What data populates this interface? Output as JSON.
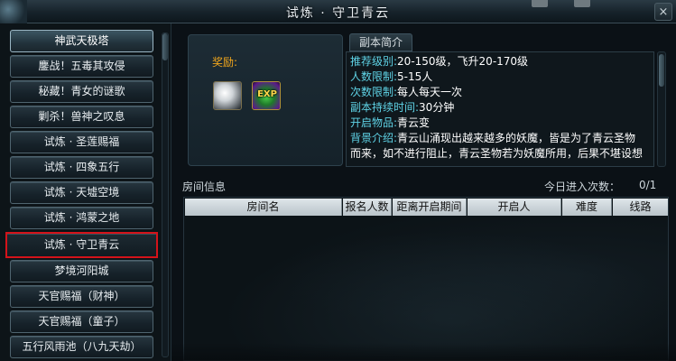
{
  "window": {
    "title": "试炼 · 守卫青云",
    "close_icon": "×"
  },
  "dungeon_list": {
    "items": [
      {
        "label": "神武天极塔",
        "state": "active"
      },
      {
        "label": "鏖战！五毒其攻侵",
        "state": "normal"
      },
      {
        "label": "秘藏！青女的谜歌",
        "state": "normal"
      },
      {
        "label": "剿杀！兽神之叹息",
        "state": "normal"
      },
      {
        "label": "试炼 · 圣莲赐福",
        "state": "normal"
      },
      {
        "label": "试炼 · 四象五行",
        "state": "normal"
      },
      {
        "label": "试炼 · 天墟空境",
        "state": "normal"
      },
      {
        "label": "试炼 · 鸿蒙之地",
        "state": "normal"
      },
      {
        "label": "试炼 · 守卫青云",
        "state": "selected-highlighted"
      },
      {
        "label": "梦境河阳城",
        "state": "normal"
      },
      {
        "label": "天官赐福（财神）",
        "state": "normal"
      },
      {
        "label": "天官赐福（童子）",
        "state": "normal"
      },
      {
        "label": "五行风雨池（八九天劫）",
        "state": "normal"
      }
    ]
  },
  "reward": {
    "label": "奖励:",
    "items": [
      {
        "icon": "silver-orb-icon"
      },
      {
        "icon": "exp-icon",
        "text": "EXP"
      }
    ]
  },
  "description": {
    "header": "副本简介",
    "lines": [
      {
        "key": "推荐级别:",
        "value": "20-150级，飞升20-170级"
      },
      {
        "key": "人数限制:",
        "value": "5-15人"
      },
      {
        "key": "次数限制:",
        "value": "每人每天一次"
      },
      {
        "key": "副本持续时间:",
        "value": "30分钟"
      },
      {
        "key": "开启物品:",
        "value": "青云变"
      },
      {
        "key": "背景介绍:",
        "value": "青云山涌现出越来越多的妖魔，皆是为了青云圣物"
      },
      {
        "key": "",
        "value": "而来，如不进行阻止，青云圣物若为妖魔所用，后果不堪设想"
      }
    ]
  },
  "room_info": {
    "title": "房间信息",
    "entry_count_label": "今日进入次数：",
    "entry_count_value": "0/1",
    "columns": [
      "房间名",
      "报名人数",
      "距离开启期间",
      "开启人",
      "难度",
      "线路"
    ]
  },
  "colors": {
    "highlight_border": "#d4131a",
    "reward_label": "#f2a71c",
    "desc_key": "#5fd3e6"
  }
}
